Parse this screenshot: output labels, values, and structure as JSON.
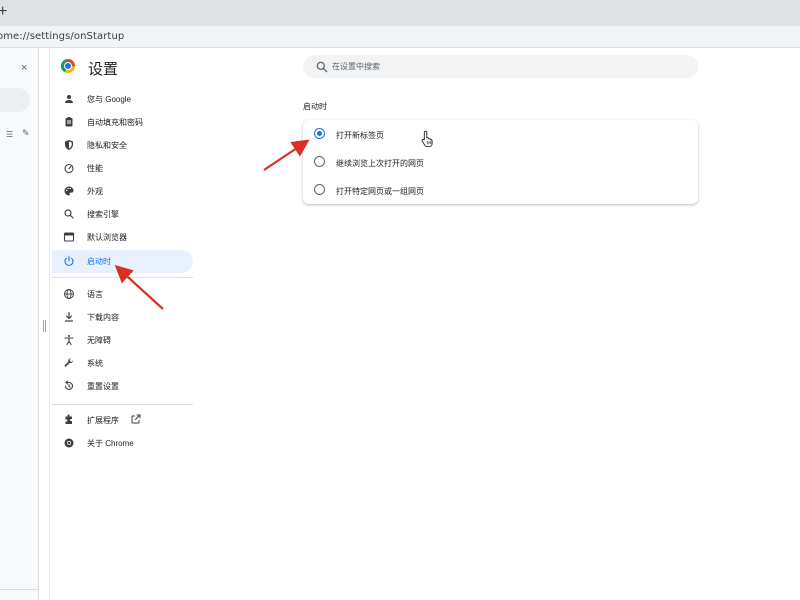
{
  "browser": {
    "new_tab_symbol": "+",
    "address": "ome://settings/onStartup"
  },
  "side_panel": {
    "close_symbol": "×"
  },
  "settings": {
    "title": "设置",
    "search_placeholder": "在设置中搜索"
  },
  "nav": {
    "items": [
      {
        "label": "您与 Google",
        "icon": "person-icon"
      },
      {
        "label": "自动填充和密码",
        "icon": "clipboard-icon"
      },
      {
        "label": "隐私和安全",
        "icon": "shield-icon"
      },
      {
        "label": "性能",
        "icon": "speedometer-icon"
      },
      {
        "label": "外观",
        "icon": "palette-icon"
      },
      {
        "label": "搜索引擎",
        "icon": "search-icon"
      },
      {
        "label": "默认浏览器",
        "icon": "browser-window-icon"
      },
      {
        "label": "启动时",
        "icon": "power-icon",
        "active": true
      },
      {
        "label": "语言",
        "icon": "globe-icon"
      },
      {
        "label": "下载内容",
        "icon": "download-icon"
      },
      {
        "label": "无障碍",
        "icon": "accessibility-icon"
      },
      {
        "label": "系统",
        "icon": "wrench-icon"
      },
      {
        "label": "重置设置",
        "icon": "reset-icon"
      },
      {
        "label": "扩展程序",
        "icon": "puzzle-icon"
      },
      {
        "label": "关于 Chrome",
        "icon": "chrome-icon"
      }
    ]
  },
  "startup": {
    "section_title": "启动时",
    "options": [
      {
        "label": "打开新标签页",
        "checked": true
      },
      {
        "label": "继续浏览上次打开的网页",
        "checked": false
      },
      {
        "label": "打开特定网页或一组网页",
        "checked": false
      }
    ]
  },
  "colors": {
    "accent": "#1a73e8",
    "annotation_arrow": "#d93025",
    "active_nav_bg": "#e8f0fe"
  }
}
